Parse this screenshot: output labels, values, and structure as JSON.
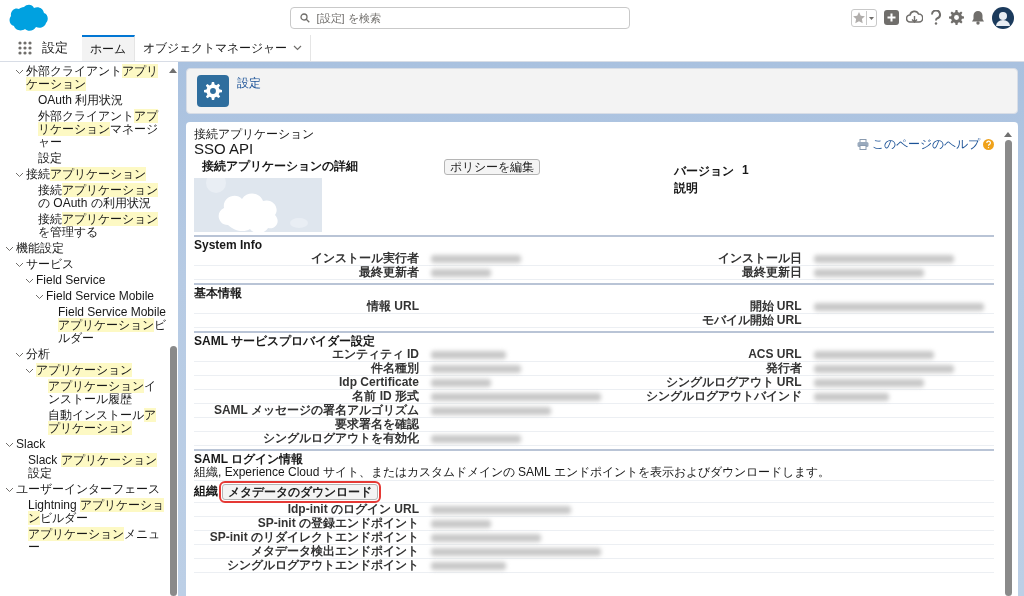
{
  "header": {
    "search": {
      "placeholder": "[設定] を検索"
    }
  },
  "nav": {
    "app_name": "設定",
    "tabs": [
      {
        "label": "ホーム",
        "selected": true,
        "dropdown": false
      },
      {
        "label": "オブジェクトマネージャー",
        "selected": false,
        "dropdown": true
      }
    ]
  },
  "sidebar": {
    "continued_items": [
      {
        "parts": [
          {
            "text": "外部クライアント",
            "highlighted": false
          },
          {
            "text": "アプリケーション",
            "highlighted": true
          }
        ],
        "expanded": true,
        "children": [
          {
            "parts": [
              {
                "text": "OAuth 利用状況",
                "highlighted": false
              }
            ]
          },
          {
            "parts": [
              {
                "text": "外部クライアント",
                "highlighted": false
              },
              {
                "text": "アプリケーション",
                "highlighted": true
              },
              {
                "text": "マネージャー",
                "highlighted": false
              }
            ]
          },
          {
            "parts": [
              {
                "text": "設定",
                "highlighted": false
              }
            ]
          }
        ]
      },
      {
        "parts": [
          {
            "text": "接続",
            "highlighted": false
          },
          {
            "text": "アプリケーション",
            "highlighted": true
          }
        ],
        "expanded": true,
        "children": [
          {
            "parts": [
              {
                "text": "接続",
                "highlighted": false
              },
              {
                "text": "アプリケーション",
                "highlighted": true
              },
              {
                "text": "の OAuth の利用状況",
                "highlighted": false
              }
            ]
          },
          {
            "parts": [
              {
                "text": "接続",
                "highlighted": false
              },
              {
                "text": "アプリケーション",
                "highlighted": true
              },
              {
                "text": "を管理する",
                "highlighted": false
              }
            ]
          }
        ]
      }
    ],
    "items": [
      {
        "parts": [
          {
            "text": "機能設定",
            "highlighted": false
          }
        ],
        "expanded": true,
        "children": [
          {
            "parts": [
              {
                "text": "サービス",
                "highlighted": false
              }
            ],
            "expanded": true,
            "children": [
              {
                "parts": [
                  {
                    "text": "Field Service",
                    "highlighted": false
                  }
                ],
                "expanded": true,
                "children": [
                  {
                    "parts": [
                      {
                        "text": "Field Service Mobile",
                        "highlighted": false
                      }
                    ],
                    "expanded": true,
                    "children": [
                      {
                        "parts": [
                          {
                            "text": "Field Service Mobile ",
                            "highlighted": false
                          },
                          {
                            "text": "アプリケーション",
                            "highlighted": true
                          },
                          {
                            "text": "ビルダー",
                            "highlighted": false
                          }
                        ]
                      }
                    ]
                  }
                ]
              }
            ]
          },
          {
            "parts": [
              {
                "text": "分析",
                "highlighted": false
              }
            ],
            "expanded": true,
            "children": [
              {
                "parts": [
                  {
                    "text": "アプリケーション",
                    "highlighted": true
                  }
                ],
                "expanded": true,
                "children": [
                  {
                    "parts": [
                      {
                        "text": "アプリケーション",
                        "highlighted": true
                      },
                      {
                        "text": "インストール履歴",
                        "highlighted": false
                      }
                    ]
                  },
                  {
                    "parts": [
                      {
                        "text": "自動インストール",
                        "highlighted": false
                      },
                      {
                        "text": "アプリケーション",
                        "highlighted": true
                      }
                    ]
                  }
                ]
              }
            ]
          }
        ]
      },
      {
        "parts": [
          {
            "text": "Slack",
            "highlighted": false
          }
        ],
        "expanded": true,
        "children": [
          {
            "parts": [
              {
                "text": "Slack ",
                "highlighted": false
              },
              {
                "text": "アプリケーション",
                "highlighted": true
              },
              {
                "text": "設定",
                "highlighted": false
              }
            ]
          }
        ]
      },
      {
        "parts": [
          {
            "text": "ユーザーインターフェース",
            "highlighted": false
          }
        ],
        "expanded": true,
        "children": [
          {
            "parts": [
              {
                "text": "Lightning ",
                "highlighted": false
              },
              {
                "text": "アプリケーション",
                "highlighted": true
              },
              {
                "text": "ビルダー",
                "highlighted": false
              }
            ]
          },
          {
            "parts": [
              {
                "text": "アプリケーション",
                "highlighted": true
              },
              {
                "text": "メニュー",
                "highlighted": false
              }
            ]
          }
        ]
      }
    ]
  },
  "page_header": {
    "breadcrumb": "設定"
  },
  "detail": {
    "eyebrow": "接続アプリケーション",
    "title": "SSO API",
    "help_link": "このページのヘルプ",
    "section_title": "接続アプリケーションの詳細",
    "edit_button": "ポリシーを編集",
    "info": [
      {
        "label": "バージョン",
        "value": "1"
      },
      {
        "label": "説明"
      }
    ],
    "sections": [
      {
        "title": "System Info",
        "rows": [
          {
            "left": {
              "label": "インストール実行者",
              "redacted": true
            },
            "right": {
              "label": "インストール日",
              "redacted": true
            }
          },
          {
            "left": {
              "label": "最終更新者",
              "redacted": true
            },
            "right": {
              "label": "最終更新日",
              "redacted": true
            }
          }
        ]
      },
      {
        "title": "基本情報",
        "rows": [
          {
            "left": {
              "label": "情報 URL",
              "redacted": false
            },
            "right": {
              "label": "開始 URL",
              "redacted": true
            }
          },
          {
            "right": {
              "label": "モバイル開始 URL",
              "redacted": false
            }
          }
        ]
      },
      {
        "title": "SAML サービスプロバイダー設定",
        "rows": [
          {
            "left": {
              "label": "エンティティ ID",
              "redacted": true
            },
            "right": {
              "label": "ACS URL",
              "redacted": true
            }
          },
          {
            "left": {
              "label": "件名種別",
              "redacted": true
            },
            "right": {
              "label": "発行者",
              "redacted": true
            }
          },
          {
            "left": {
              "label": "Idp Certificate",
              "redacted": true
            },
            "right": {
              "label": "シングルログアウト URL",
              "redacted": true
            }
          },
          {
            "left": {
              "label": "名前 ID 形式",
              "redacted": true
            },
            "right": {
              "label": "シングルログアウトバインド",
              "redacted": true
            }
          },
          {
            "left": {
              "label": "SAML メッセージの署名アルゴリズム",
              "redacted": true
            }
          },
          {
            "left": {
              "label": "要求署名を確認",
              "redacted": false
            }
          },
          {
            "left": {
              "label": "シングルログアウトを有効化",
              "redacted": true
            }
          }
        ]
      },
      {
        "title": "SAML ログイン情報",
        "note": "組織, Experience Cloud サイト、またはカスタムドメインの SAML エンドポイントを表示およびダウンロードします。",
        "action": {
          "label": "組織",
          "button": "メタデータのダウンロード",
          "highlighted": true
        },
        "rows": [
          {
            "left": {
              "label": "Idp-init のログイン URL",
              "redacted": true
            }
          },
          {
            "left": {
              "label": "SP-init の登録エンドポイント",
              "redacted": true
            }
          },
          {
            "left": {
              "label": "SP-init のリダイレクトエンドポイント",
              "redacted": true
            }
          },
          {
            "left": {
              "label": "メタデータ検出エンドポイント",
              "redacted": true
            }
          },
          {
            "left": {
              "label": "シングルログアウトエンドポイント",
              "redacted": true
            }
          }
        ]
      }
    ]
  }
}
